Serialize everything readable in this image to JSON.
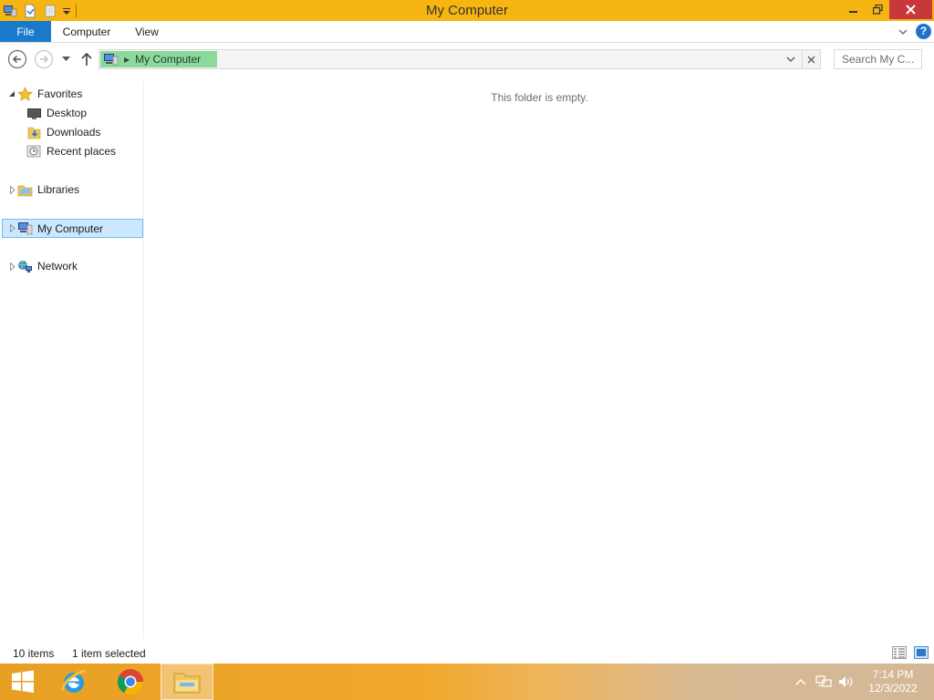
{
  "window": {
    "title": "My Computer",
    "accent": "#f7b512"
  },
  "ribbon": {
    "tabs": [
      {
        "label": "File"
      },
      {
        "label": "Computer"
      },
      {
        "label": "View"
      }
    ],
    "help_label": "?"
  },
  "navbar": {
    "address_crumb": "My Computer",
    "search_placeholder": "Search My C..."
  },
  "navpane": {
    "favorites": "Favorites",
    "desktop": "Desktop",
    "downloads": "Downloads",
    "recent": "Recent places",
    "libraries": "Libraries",
    "my_computer": "My Computer",
    "network": "Network"
  },
  "content": {
    "empty_message": "This folder is empty."
  },
  "status": {
    "count": "10 items",
    "selected": "1 item selected"
  },
  "taskbar": {
    "time": "7:14 PM",
    "date": "12/3/2022",
    "apps": [
      "internet-explorer",
      "chrome",
      "file-explorer"
    ]
  }
}
